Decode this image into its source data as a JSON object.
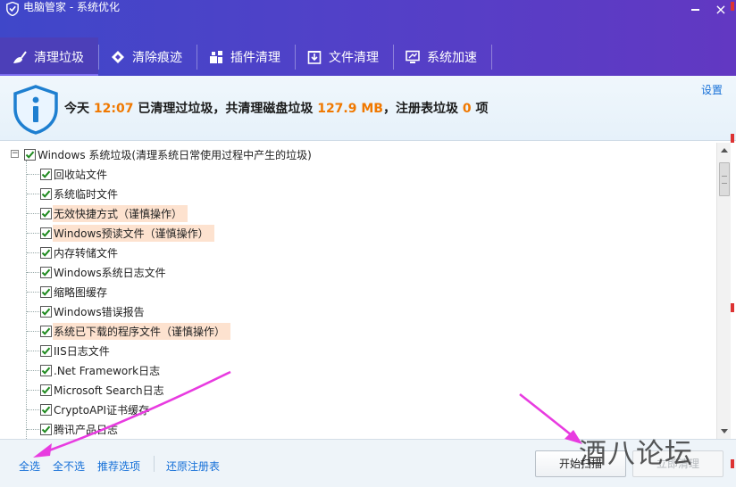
{
  "window": {
    "title": "电脑管家 - 系统优化",
    "close_glyph": "×"
  },
  "tabs": [
    {
      "label": "清理垃圾",
      "icon": "broom-icon",
      "active": true
    },
    {
      "label": "清除痕迹",
      "icon": "eraser-icon",
      "active": false
    },
    {
      "label": "插件清理",
      "icon": "plugin-icon",
      "active": false
    },
    {
      "label": "文件清理",
      "icon": "file-box-icon",
      "active": false
    },
    {
      "label": "系统加速",
      "icon": "monitor-speed-icon",
      "active": false
    }
  ],
  "info": {
    "icon": "info-shield-icon",
    "prefix": "今天 ",
    "time": "12:07",
    "mid1": " 已清理过垃圾，共清理磁盘垃圾 ",
    "size": "127.9 MB",
    "mid2": "，注册表垃圾 ",
    "reg_count": "0",
    "suffix": " 项",
    "settings_label": "设置",
    "highlight_color": "#f07800"
  },
  "tree": {
    "root": {
      "label": "Windows 系统垃圾(清理系统日常使用过程中产生的垃圾)",
      "checked": true,
      "expanded": true
    },
    "items": [
      {
        "label": "回收站文件",
        "checked": true,
        "warning": false
      },
      {
        "label": "系统临时文件",
        "checked": true,
        "warning": false
      },
      {
        "label": "无效快捷方式（谨慎操作）",
        "checked": true,
        "warning": true
      },
      {
        "label": "Windows预读文件（谨慎操作）",
        "checked": true,
        "warning": true
      },
      {
        "label": "内存转储文件",
        "checked": true,
        "warning": false
      },
      {
        "label": "Windows系统日志文件",
        "checked": true,
        "warning": false
      },
      {
        "label": "缩略图缓存",
        "checked": true,
        "warning": false
      },
      {
        "label": "Windows错误报告",
        "checked": true,
        "warning": false
      },
      {
        "label": "系统已下载的程序文件（谨慎操作）",
        "checked": true,
        "warning": true
      },
      {
        "label": "IIS日志文件",
        "checked": true,
        "warning": false
      },
      {
        "label": ".Net Framework日志",
        "checked": true,
        "warning": false
      },
      {
        "label": "Microsoft Search日志",
        "checked": true,
        "warning": false
      },
      {
        "label": "CryptoAPI证书缓存",
        "checked": true,
        "warning": false
      },
      {
        "label": "腾讯产品日志",
        "checked": true,
        "warning": false
      }
    ]
  },
  "footer": {
    "select_all": "全选",
    "select_none": "全不选",
    "recommended": "推荐选项",
    "restore_registry": "还原注册表",
    "scan_button": "开始扫描",
    "clean_button": "立即清理"
  },
  "annotations": {
    "arrow_color": "#e83be0",
    "watermark": "酒八论坛"
  },
  "colors": {
    "accent_purple": "#5141c8",
    "link_blue": "#1670d8",
    "warning_bg": "#fde2cf",
    "check_green": "#1f8a1f"
  }
}
